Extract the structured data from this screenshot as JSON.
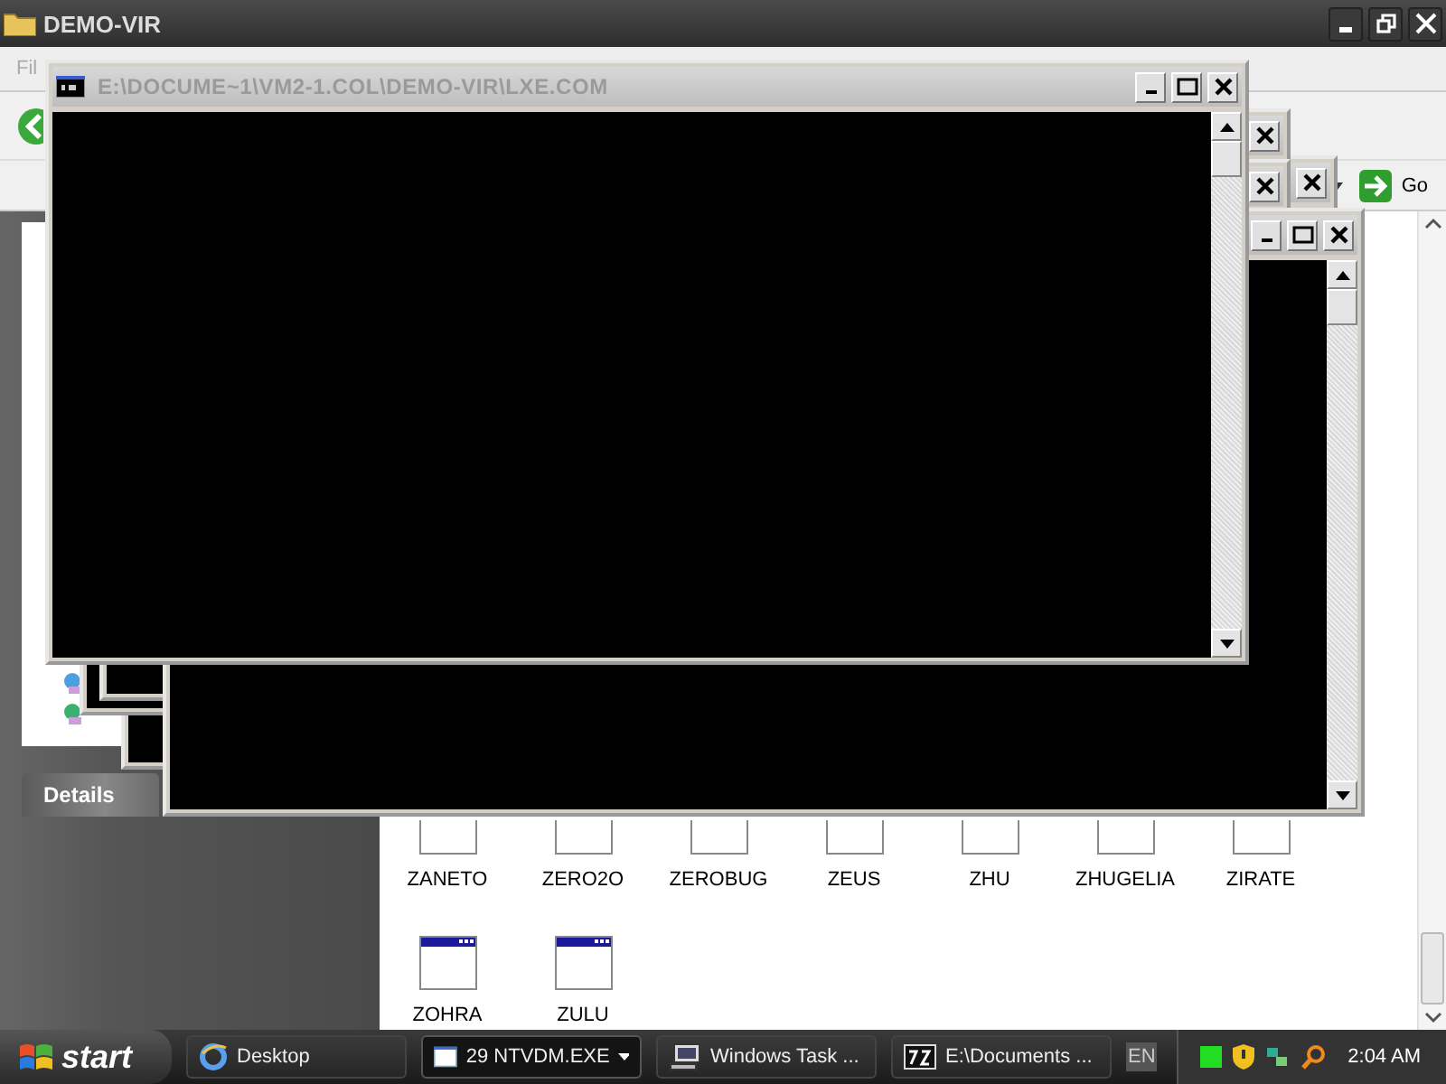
{
  "explorer": {
    "title": "DEMO-VIR",
    "menu": [
      "Fil"
    ],
    "go_button": "Go",
    "details_header": "Details",
    "files": [
      {
        "name": "ZANETO"
      },
      {
        "name": "ZERO2O"
      },
      {
        "name": "ZEROBUG"
      },
      {
        "name": "ZEUS"
      },
      {
        "name": "ZHU"
      },
      {
        "name": "ZHUGELIA"
      },
      {
        "name": "ZIRATE"
      },
      {
        "name": "ZOHRA"
      },
      {
        "name": "ZULU"
      }
    ]
  },
  "console_window": {
    "title": "E:\\DOCUME~1\\VM2-1.COL\\DEMO-VIR\\LXE.COM"
  },
  "taskbar": {
    "start": "start",
    "buttons": [
      {
        "label": "Desktop",
        "kind": "ie",
        "selected": false
      },
      {
        "label": "29 NTVDM.EXE",
        "kind": "group",
        "selected": true
      },
      {
        "label": "Windows Task ...",
        "kind": "taskmgr",
        "selected": false
      },
      {
        "label": "E:\\Documents ...",
        "kind": "sevenzip",
        "selected": false
      }
    ],
    "language": "EN",
    "clock": "2:04 AM"
  }
}
